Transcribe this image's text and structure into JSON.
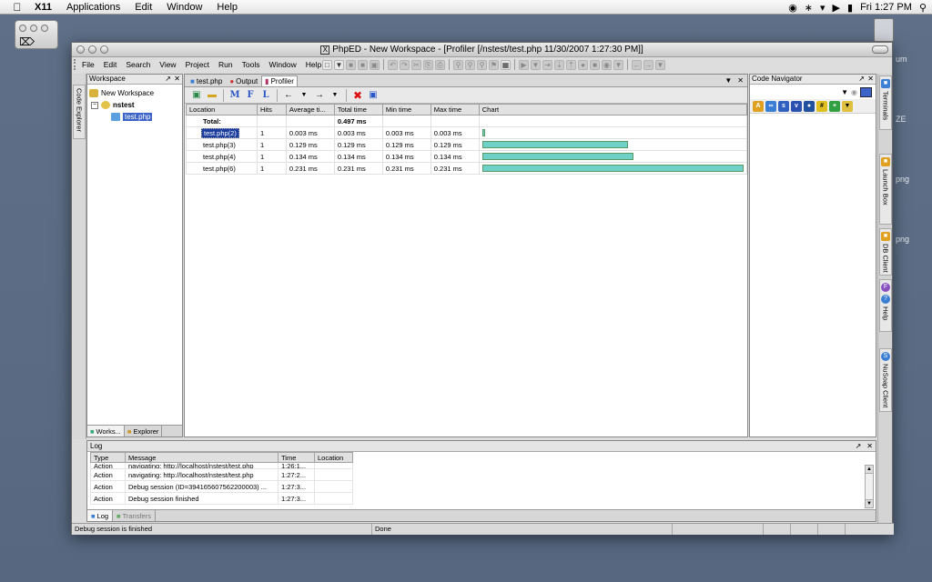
{
  "menubar": {
    "app": "X11",
    "items": [
      "Applications",
      "Edit",
      "Window",
      "Help"
    ],
    "clock": "Fri 1:27 PM"
  },
  "desktop": {
    "labels": [
      "um",
      "ZE",
      "png",
      "png"
    ]
  },
  "window": {
    "title": "PhpED - New Workspace - [Profiler [/nstest/test.php  11/30/2007 1:27:30 PM]]",
    "menu": [
      "File",
      "Edit",
      "Search",
      "View",
      "Project",
      "Run",
      "Tools",
      "Window",
      "Help"
    ]
  },
  "left_strip": {
    "code_explorer": "Code Explorer"
  },
  "workspace": {
    "header": "Workspace",
    "root": "New Workspace",
    "project": "nstest",
    "file": "test.php",
    "tabs": [
      "Works...",
      "Explorer"
    ]
  },
  "editor": {
    "tabs": [
      "test.php",
      "Output",
      "Profiler"
    ],
    "tool_letters": [
      "M",
      "F",
      "L"
    ],
    "columns": [
      "Location",
      "Hits",
      "Average ti...",
      "Total time",
      "Min time",
      "Max time",
      "Chart"
    ],
    "total_label": "Total:",
    "total_time": "0.497 ms",
    "rows": [
      {
        "location": "test.php(2)",
        "hits": "1",
        "avg": "0.003 ms",
        "total": "0.003 ms",
        "min": "0.003 ms",
        "max": "0.003 ms",
        "ratio": 0.013
      },
      {
        "location": "test.php(3)",
        "hits": "1",
        "avg": "0.129 ms",
        "total": "0.129 ms",
        "min": "0.129 ms",
        "max": "0.129 ms",
        "ratio": 0.558
      },
      {
        "location": "test.php(4)",
        "hits": "1",
        "avg": "0.134 ms",
        "total": "0.134 ms",
        "min": "0.134 ms",
        "max": "0.134 ms",
        "ratio": 0.58
      },
      {
        "location": "test.php(6)",
        "hits": "1",
        "avg": "0.231 ms",
        "total": "0.231 ms",
        "min": "0.231 ms",
        "max": "0.231 ms",
        "ratio": 1.0
      }
    ]
  },
  "code_navigator": {
    "header": "Code Navigator"
  },
  "right_strip": [
    "Terminals",
    "Launch Box",
    "DB Client",
    "Help",
    "NuSoap Client"
  ],
  "log": {
    "header": "Log",
    "columns": [
      "Type",
      "Message",
      "Time",
      "Location"
    ],
    "rows": [
      {
        "type": "Action",
        "message": "navigating: http://localhost/nstest/test.php",
        "time": "1:26:1..."
      },
      {
        "type": "Action",
        "message": "navigating: http://localhost/nstest/test.php",
        "time": "1:27:2..."
      },
      {
        "type": "Action",
        "message": "Debug session  (ID=394165607562200003) ...",
        "time": "1:27:3..."
      },
      {
        "type": "Action",
        "message": "Debug session finished",
        "time": "1:27:3..."
      }
    ],
    "tabs": [
      "Log",
      "Transfers"
    ]
  },
  "status": {
    "left": "Debug session is finished",
    "middle": "Done"
  },
  "colors": {
    "desktop": "#5e6f87",
    "chart_bar": "#6fd0c8",
    "selection": "#1b3e9e"
  }
}
